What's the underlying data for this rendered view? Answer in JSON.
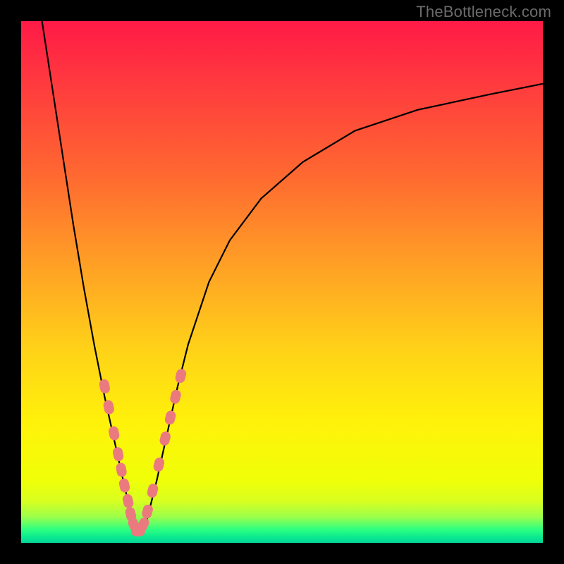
{
  "watermark": "TheBottleneck.com",
  "colors": {
    "frame": "#000000",
    "gradient_top": "#ff1a47",
    "gradient_mid1": "#ff6a30",
    "gradient_mid2": "#ffd218",
    "gradient_mid3": "#fff20a",
    "gradient_bottom": "#06d49a",
    "curve": "#000000",
    "beads": "#eb7a7f"
  },
  "chart_data": {
    "type": "line",
    "title": "",
    "xlabel": "",
    "ylabel": "",
    "xlim": [
      0,
      100
    ],
    "ylim": [
      0,
      100
    ],
    "grid": false,
    "legend": false,
    "annotations": [
      "TheBottleneck.com"
    ],
    "series": [
      {
        "name": "bottleneck-curve",
        "description": "V-shaped bottleneck curve; minimum near x≈22, right arm asymptotes toward high y",
        "x": [
          4,
          6,
          8,
          10,
          12,
          14,
          16,
          18,
          20,
          22,
          24,
          26,
          28,
          30,
          32,
          36,
          40,
          46,
          54,
          64,
          76,
          90,
          100
        ],
        "y": [
          100,
          87,
          74,
          61,
          49,
          38,
          28,
          19,
          10,
          2,
          4,
          12,
          21,
          30,
          38,
          50,
          58,
          66,
          73,
          79,
          83,
          86,
          88
        ]
      }
    ],
    "markers": {
      "name": "highlighted-beads",
      "description": "Salmon dashed bead segments near the curve minimum on both arms",
      "points": [
        {
          "x": 16.0,
          "y": 30
        },
        {
          "x": 16.8,
          "y": 26
        },
        {
          "x": 17.8,
          "y": 21
        },
        {
          "x": 18.6,
          "y": 17
        },
        {
          "x": 19.2,
          "y": 14
        },
        {
          "x": 19.8,
          "y": 11
        },
        {
          "x": 20.5,
          "y": 8
        },
        {
          "x": 21.0,
          "y": 5.5
        },
        {
          "x": 21.6,
          "y": 3.5
        },
        {
          "x": 22.4,
          "y": 2.2
        },
        {
          "x": 23.4,
          "y": 3.5
        },
        {
          "x": 24.2,
          "y": 6
        },
        {
          "x": 25.2,
          "y": 10
        },
        {
          "x": 26.4,
          "y": 15
        },
        {
          "x": 27.6,
          "y": 20
        },
        {
          "x": 28.6,
          "y": 24
        },
        {
          "x": 29.6,
          "y": 28
        },
        {
          "x": 30.6,
          "y": 32
        }
      ]
    }
  }
}
